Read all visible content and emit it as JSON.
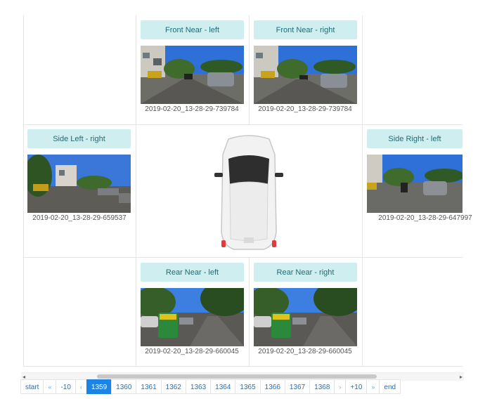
{
  "cameras": {
    "front_near_left": {
      "label": "Front Near - left",
      "timestamp": "2019-02-20_13-28-29-739784"
    },
    "front_near_right": {
      "label": "Front Near - right",
      "timestamp": "2019-02-20_13-28-29-739784"
    },
    "side_left_right": {
      "label": "Side Left - right",
      "timestamp": "2019-02-20_13-28-29-659537"
    },
    "side_right_left": {
      "label": "Side Right - left",
      "timestamp": "2019-02-20_13-28-29-647997"
    },
    "rear_near_left": {
      "label": "Rear Near - left",
      "timestamp": "2019-02-20_13-28-29-660045"
    },
    "rear_near_right": {
      "label": "Rear Near - right",
      "timestamp": "2019-02-20_13-28-29-660045"
    }
  },
  "pagination": {
    "start": "start",
    "prev_fast": "«",
    "minus10": "-10",
    "prev": "‹",
    "pages": [
      "1359",
      "1360",
      "1361",
      "1362",
      "1363",
      "1364",
      "1365",
      "1366",
      "1367",
      "1368"
    ],
    "active_page": "1359",
    "next": "›",
    "plus10": "+10",
    "next_fast": "»",
    "end": "end"
  },
  "colors": {
    "label_bg": "#cfeef0",
    "label_text": "#1f6b73",
    "active_page": "#1b84e7",
    "link": "#2a6fb0"
  }
}
